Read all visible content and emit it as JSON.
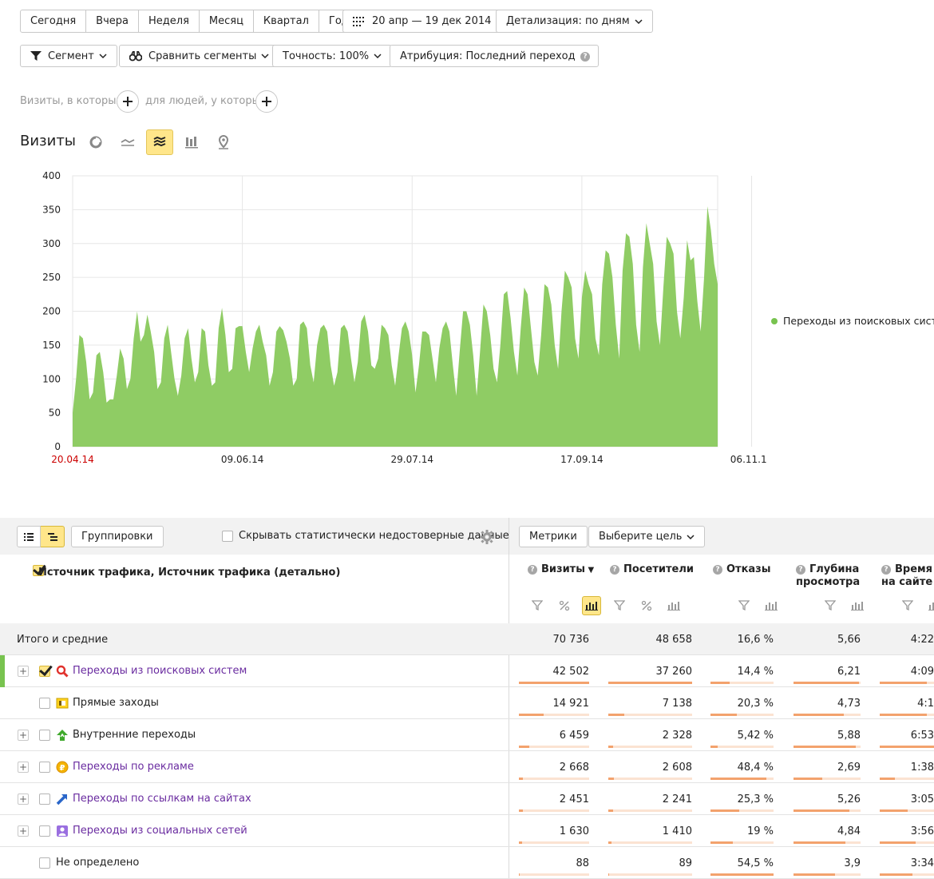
{
  "periods": [
    "Сегодня",
    "Вчера",
    "Неделя",
    "Месяц",
    "Квартал",
    "Год"
  ],
  "date_range": "20 апр — 19 дек 2014",
  "detail": "Детализация: по дням",
  "filters": {
    "segment": "Сегмент",
    "compare": "Сравнить сегменты",
    "accuracy": "Точность: 100%",
    "attribution": "Атрибуция: Последний переход"
  },
  "condition": {
    "visits_label": "Визиты, в которых",
    "people_label": "для людей, у которых"
  },
  "chart_title": "Визиты",
  "chart_data": {
    "type": "area",
    "series": [
      {
        "name": "Переходы из поисковых систем",
        "color": "#8fcc64"
      }
    ],
    "x_start": "20.04.14",
    "x_end": "19.12.14",
    "x_ticks": [
      "20.04.14",
      "09.06.14",
      "29.07.14",
      "17.09.14",
      "06.11.14"
    ],
    "y_ticks": [
      "0",
      "50",
      "100",
      "150",
      "200",
      "250",
      "300",
      "350",
      "400"
    ],
    "ylim": [
      0,
      400
    ],
    "values": [
      50,
      100,
      165,
      160,
      125,
      70,
      80,
      135,
      140,
      110,
      65,
      70,
      70,
      105,
      145,
      130,
      85,
      100,
      160,
      200,
      155,
      165,
      195,
      170,
      140,
      85,
      95,
      160,
      180,
      140,
      100,
      75,
      105,
      160,
      175,
      130,
      95,
      110,
      175,
      170,
      120,
      90,
      95,
      175,
      205,
      165,
      110,
      115,
      175,
      178,
      178,
      140,
      110,
      145,
      170,
      180,
      155,
      135,
      90,
      110,
      170,
      178,
      172,
      155,
      130,
      90,
      100,
      180,
      185,
      175,
      120,
      95,
      150,
      175,
      180,
      170,
      120,
      90,
      110,
      175,
      180,
      170,
      130,
      95,
      125,
      185,
      195,
      170,
      120,
      115,
      130,
      180,
      175,
      165,
      120,
      90,
      135,
      175,
      185,
      170,
      135,
      80,
      120,
      170,
      170,
      165,
      130,
      95,
      145,
      175,
      185,
      170,
      120,
      75,
      140,
      200,
      200,
      180,
      135,
      75,
      140,
      210,
      200,
      165,
      115,
      95,
      150,
      225,
      230,
      190,
      140,
      105,
      175,
      235,
      225,
      175,
      125,
      105,
      165,
      240,
      235,
      210,
      150,
      115,
      200,
      260,
      250,
      235,
      160,
      130,
      220,
      260,
      240,
      225,
      160,
      135,
      240,
      290,
      285,
      250,
      180,
      130,
      260,
      315,
      310,
      270,
      180,
      140,
      265,
      330,
      300,
      270,
      185,
      150,
      235,
      310,
      300,
      285,
      200,
      160,
      220,
      305,
      275,
      280,
      215,
      170,
      250,
      355,
      320,
      270,
      240
    ],
    "legend_position": "right"
  },
  "table_toolbar": {
    "groupings": "Группировки",
    "hide_unreliable": "Скрывать статистически недостоверные данные",
    "metrics": "Метрики",
    "goal": "Выберите цель"
  },
  "dimension_header": "Источник трафика, Источник трафика (детально)",
  "columns": [
    "Визиты",
    "Посетители",
    "Отказы",
    "Глубина просмотра",
    "Время на сайте"
  ],
  "columns_lines": [
    [
      "Визиты"
    ],
    [
      "Посетители"
    ],
    [
      "Отказы"
    ],
    [
      "Глубина",
      "просмотра"
    ],
    [
      "Время",
      "на сайте"
    ]
  ],
  "sort_marker": "▼",
  "totals": {
    "label": "Итого и средние",
    "values": [
      "70 736",
      "48 658",
      "16,6 %",
      "5,66",
      "4:22"
    ]
  },
  "rows": [
    {
      "name": "Переходы из поисковых систем",
      "link": true,
      "expand": true,
      "checked": true,
      "icon": "search-icon",
      "values": [
        "42 502",
        "37 260",
        "14,4 %",
        "6,21",
        "4:09"
      ],
      "bars": [
        1.0,
        1.0,
        0.3,
        0.98,
        0.78
      ]
    },
    {
      "name": "Прямые заходы",
      "link": false,
      "expand": false,
      "checked": false,
      "icon": "direct-icon",
      "values": [
        "14 921",
        "7 138",
        "20,3 %",
        "4,73",
        "4:1"
      ],
      "bars": [
        0.35,
        0.19,
        0.42,
        0.75,
        0.79
      ]
    },
    {
      "name": "Внутренние переходы",
      "link": false,
      "expand": true,
      "checked": false,
      "icon": "internal-icon",
      "values": [
        "6 459",
        "2 328",
        "5,42 %",
        "5,88",
        "6:53"
      ],
      "bars": [
        0.15,
        0.06,
        0.11,
        0.93,
        1.0
      ]
    },
    {
      "name": "Переходы по рекламе",
      "link": true,
      "expand": true,
      "checked": false,
      "icon": "ad-icon",
      "values": [
        "2 668",
        "2 608",
        "48,4 %",
        "2,69",
        "1:38"
      ],
      "bars": [
        0.06,
        0.07,
        0.89,
        0.43,
        0.25
      ]
    },
    {
      "name": "Переходы по ссылкам на сайтах",
      "link": true,
      "expand": true,
      "checked": false,
      "icon": "link-icon",
      "values": [
        "2 451",
        "2 241",
        "25,3 %",
        "5,26",
        "3:05"
      ],
      "bars": [
        0.06,
        0.06,
        0.46,
        0.83,
        0.47
      ]
    },
    {
      "name": "Переходы из социальных сетей",
      "link": true,
      "expand": true,
      "checked": false,
      "icon": "social-icon",
      "values": [
        "1 630",
        "1 410",
        "19 %",
        "4,84",
        "3:56"
      ],
      "bars": [
        0.04,
        0.04,
        0.35,
        0.77,
        0.6
      ]
    },
    {
      "name": "Не определено",
      "link": false,
      "expand": false,
      "checked": false,
      "icon": "",
      "values": [
        "88",
        "89",
        "54,5 %",
        "3,9",
        "3:34"
      ],
      "bars": [
        0.003,
        0.003,
        1.0,
        0.62,
        0.55
      ]
    }
  ]
}
